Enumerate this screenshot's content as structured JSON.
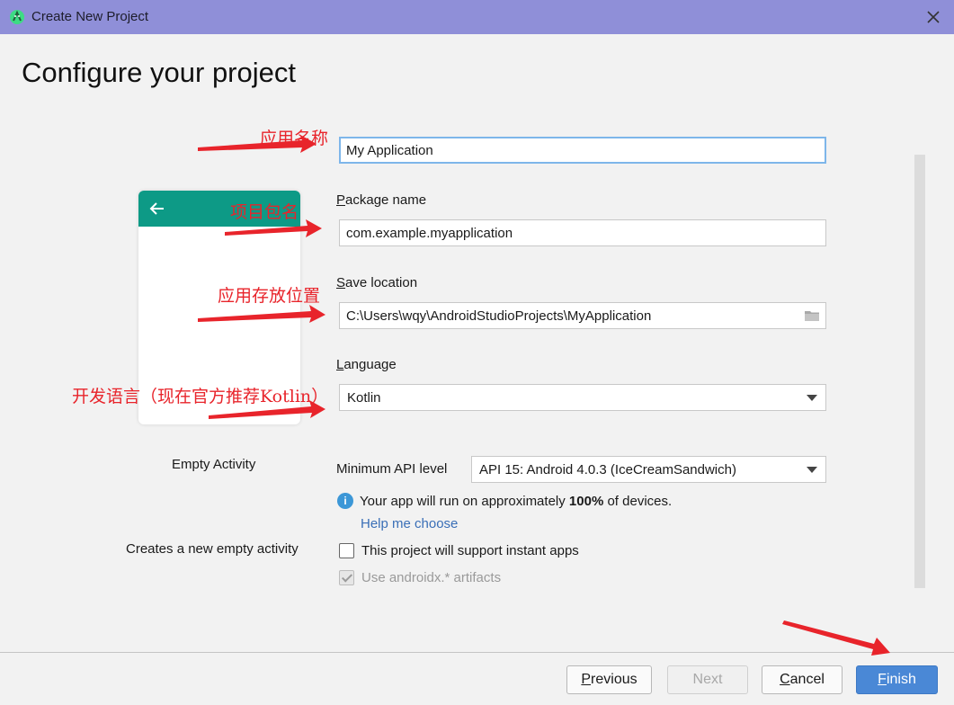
{
  "window": {
    "title": "Create New Project",
    "app_icon": "android-studio-icon",
    "close_icon": "close-icon"
  },
  "page": {
    "heading": "Configure your project"
  },
  "preview": {
    "back_icon": "arrow-back-icon",
    "bar_color": "#0d9a86"
  },
  "template": {
    "name": "Empty Activity",
    "description": "Creates a new empty activity"
  },
  "form": {
    "name_value": "My Application",
    "package": {
      "label_mnemonic": "P",
      "label_rest": "ackage name",
      "value": "com.example.myapplication"
    },
    "location": {
      "label_mnemonic": "S",
      "label_rest": "ave location",
      "value": "C:\\Users\\wqy\\AndroidStudioProjects\\MyApplication",
      "icon": "folder-icon"
    },
    "language": {
      "label_mnemonic": "L",
      "label_rest": "anguage",
      "value": "Kotlin"
    },
    "min_api": {
      "label": "Minimum API level",
      "value": "API 15: Android 4.0.3 (IceCreamSandwich)"
    },
    "info": {
      "before": "Your app will run on approximately ",
      "bold": "100%",
      "after": " of devices.",
      "icon": "info-icon"
    },
    "help_link": "Help me choose",
    "instant_apps": {
      "label": "This project will support instant apps",
      "checked": false
    },
    "androidx": {
      "label": "Use androidx.* artifacts",
      "checked": true,
      "disabled": true
    }
  },
  "buttons": {
    "previous": {
      "mnemonic": "P",
      "rest": "revious"
    },
    "next": "Next",
    "cancel": {
      "mnemonic": "C",
      "rest": "ancel"
    },
    "finish": {
      "mnemonic": "F",
      "rest": "inish"
    }
  },
  "annotations": {
    "app_name": "应用名称",
    "package_name": "项目包名",
    "save_location": "应用存放位置",
    "language": "开发语言（现在官方推荐Kotlin）"
  },
  "colors": {
    "title_bar": "#8f8fd8",
    "accent": "#4a88d6",
    "link": "#3a6fb7",
    "annotation": "#e8242b"
  }
}
